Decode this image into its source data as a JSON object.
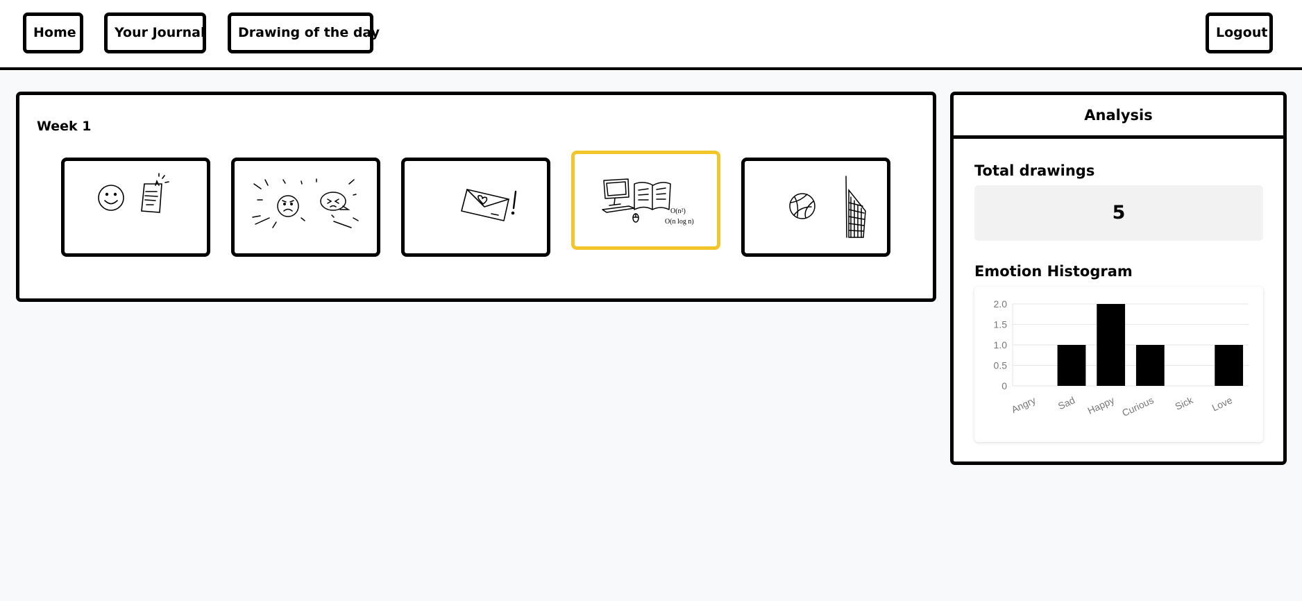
{
  "nav": {
    "home_label": "Home",
    "journal_label": "Your Journal",
    "drawing_label": "Drawing of the day",
    "logout_label": "Logout"
  },
  "week": {
    "title": "Week 1",
    "selected_index": 3,
    "thumbnails": [
      {
        "icon": "smiley-and-graded-paper-drawing"
      },
      {
        "icon": "sad-and-angry-faces-drawing"
      },
      {
        "icon": "love-letter-drawing"
      },
      {
        "icon": "computer-and-book-drawing"
      },
      {
        "icon": "volleyball-and-net-drawing"
      }
    ]
  },
  "analysis": {
    "title": "Analysis",
    "total_label": "Total drawings",
    "total_value": "5",
    "histogram_label": "Emotion Histogram"
  },
  "colors": {
    "selected_border": "#f2c52a",
    "bar": "#000000",
    "page_bg": "#f8f9fa"
  },
  "chart_data": {
    "type": "bar",
    "categories": [
      "Angry",
      "Sad",
      "Happy",
      "Curious",
      "Sick",
      "Love"
    ],
    "values": [
      0,
      1,
      2,
      1,
      0,
      1
    ],
    "yticks": [
      "0",
      "0.5",
      "1.0",
      "1.5",
      "2.0"
    ],
    "ylim": [
      0,
      2
    ],
    "grid": true,
    "legend": "none"
  }
}
